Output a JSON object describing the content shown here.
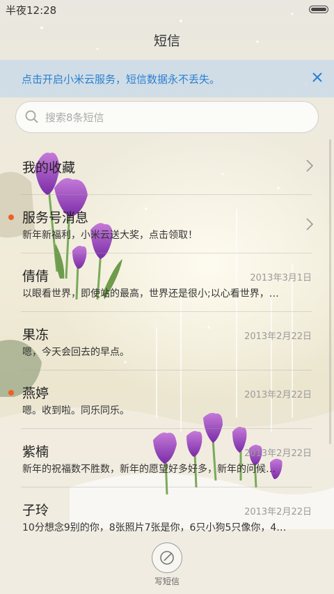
{
  "status_bar": {
    "time": "半夜12:28"
  },
  "header": {
    "title": "短信"
  },
  "banner": {
    "text": "点击开启小米云服务，短信数据永不丢失。"
  },
  "search": {
    "placeholder": "搜索8条短信"
  },
  "conversations": [
    {
      "title": "我的收藏",
      "subtitle": "",
      "date": "",
      "unread": false,
      "chevron": true
    },
    {
      "title": "服务号消息",
      "subtitle": "新年新福利，小米云送大奖，点击领取！",
      "date": "",
      "unread": true,
      "chevron": true
    },
    {
      "title": "倩倩",
      "subtitle": "以眼看世界，即使站的最高，世界还是很小;以心看世界，…",
      "date": "2013年3月1日",
      "unread": false,
      "chevron": false
    },
    {
      "title": "果冻",
      "subtitle": "嗯，今天会回去的早点。",
      "date": "2013年2月22日",
      "unread": false,
      "chevron": false
    },
    {
      "title": "燕婷",
      "subtitle": "嗯。收到啦。同乐同乐。",
      "date": "2013年2月22日",
      "unread": true,
      "chevron": false
    },
    {
      "title": "紫楠",
      "subtitle": "新年的祝福数不胜数，新年的愿望好多好多，新年的问候…",
      "date": "2013年2月22日",
      "unread": false,
      "chevron": false
    },
    {
      "title": "子玲",
      "subtitle": "10分想念9别的你，8张照片7张是你，6只小狗5只像你，4…",
      "date": "2013年2月22日",
      "unread": false,
      "chevron": false
    }
  ],
  "compose": {
    "label": "写短信"
  },
  "colors": {
    "accent": "#2a7fd0",
    "unread_dot": "#f06022"
  }
}
